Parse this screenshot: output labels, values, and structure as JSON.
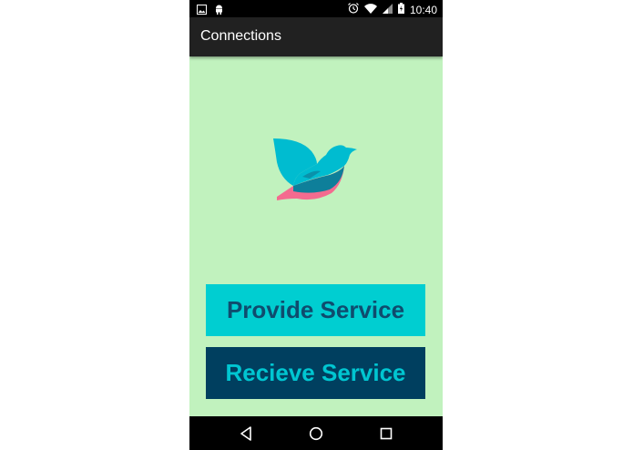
{
  "status_bar": {
    "time": "10:40",
    "left_icons": [
      "image-icon",
      "android-icon"
    ],
    "right_icons": [
      "alarm-icon",
      "wifi-icon",
      "signal-icon",
      "battery-icon"
    ]
  },
  "app_bar": {
    "title": "Connections"
  },
  "main": {
    "logo_icon": "bird-icon",
    "buttons": [
      {
        "label": "Provide Service",
        "background": "#00CED1",
        "text_color": "#0F4C6E"
      },
      {
        "label": "Recieve Service",
        "background": "#003F5F",
        "text_color": "#00C6D1"
      }
    ]
  },
  "nav_bar": {
    "icons": [
      "back-icon",
      "home-icon",
      "recents-icon"
    ]
  },
  "colors": {
    "screen_background": "#C1F2BE",
    "app_bar": "#212121",
    "status_bar": "#000000",
    "nav_bar": "#000000",
    "bird_teal": "#00BCD0",
    "bird_dark": "#0E7F9A",
    "bird_pink": "#F46B8F"
  }
}
